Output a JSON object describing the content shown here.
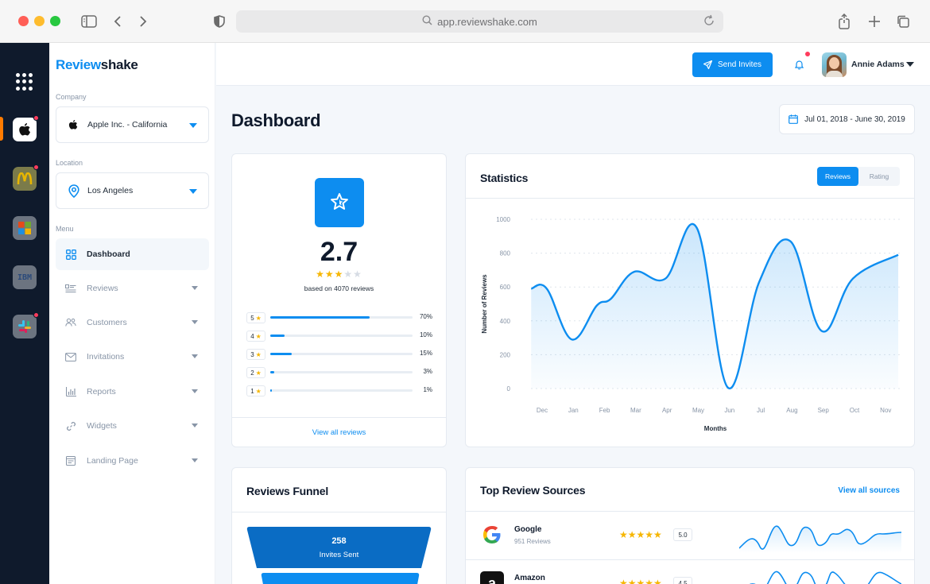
{
  "browser": {
    "url": "app.reviewshake.com"
  },
  "rail": {
    "apps": [
      {
        "name": "apple-app",
        "has_badge": true,
        "active": true
      },
      {
        "name": "mcdonalds-app",
        "has_badge": true,
        "active": false
      },
      {
        "name": "microsoft-app",
        "has_badge": false,
        "active": false
      },
      {
        "name": "ibm-app",
        "has_badge": false,
        "active": false,
        "glyph": "IBM"
      },
      {
        "name": "slack-app",
        "has_badge": true,
        "active": false
      }
    ]
  },
  "sidebar": {
    "logo_part1": "Review",
    "logo_part2": "shake",
    "company_label": "Company",
    "company_value": "Apple Inc. - California",
    "location_label": "Location",
    "location_value": "Los Angeles",
    "menu_label": "Menu",
    "items": [
      {
        "label": "Dashboard",
        "icon": "dashboard-icon",
        "active": true,
        "has_caret": false
      },
      {
        "label": "Reviews",
        "icon": "reviews-icon",
        "active": false,
        "has_caret": true
      },
      {
        "label": "Customers",
        "icon": "customers-icon",
        "active": false,
        "has_caret": true
      },
      {
        "label": "Invitations",
        "icon": "mail-icon",
        "active": false,
        "has_caret": true
      },
      {
        "label": "Reports",
        "icon": "bar-chart-icon",
        "active": false,
        "has_caret": true
      },
      {
        "label": "Widgets",
        "icon": "link-icon",
        "active": false,
        "has_caret": true
      },
      {
        "label": "Landing Page",
        "icon": "landing-page-icon",
        "active": false,
        "has_caret": true
      }
    ]
  },
  "topbar": {
    "send_invites": "Send Invites",
    "user_name": "Annie Adams"
  },
  "page": {
    "title": "Dashboard",
    "date_range": "Jul 01, 2018 - June 30, 2019"
  },
  "rating": {
    "value": "2.7",
    "stars_filled": 3,
    "stars_total": 5,
    "note": "based on 4070 reviews",
    "breakdown": [
      {
        "stars": "5",
        "percent": "70%",
        "fraction": 0.7
      },
      {
        "stars": "4",
        "percent": "10%",
        "fraction": 0.1
      },
      {
        "stars": "3",
        "percent": "15%",
        "fraction": 0.15
      },
      {
        "stars": "2",
        "percent": "3%",
        "fraction": 0.03
      },
      {
        "stars": "1",
        "percent": "1%",
        "fraction": 0.01
      }
    ],
    "view_all": "View all reviews"
  },
  "statistics": {
    "title": "Statistics",
    "tab_reviews": "Reviews",
    "tab_rating": "Rating",
    "active_tab": "Reviews"
  },
  "chart_data": {
    "type": "line",
    "title": "",
    "xlabel": "Months",
    "ylabel": "Number of Reviews",
    "categories": [
      "Dec",
      "Jan",
      "Feb",
      "Mar",
      "Apr",
      "May",
      "Jun",
      "Jul",
      "Aug",
      "Sep",
      "Oct",
      "Nov"
    ],
    "y_ticks": [
      0,
      200,
      400,
      600,
      800,
      1000
    ],
    "ylim": [
      0,
      1000
    ],
    "grid": true,
    "area_fill": true,
    "series": [
      {
        "values": [
          590,
          590,
          290,
          490,
          530,
          690,
          650,
          950,
          5,
          630,
          870,
          340,
          650,
          790
        ]
      }
    ],
    "x_positions": [
      -0.35,
      0.15,
      0.95,
      1.75,
      2.2,
      2.95,
      3.95,
      4.95,
      5.95,
      6.95,
      7.95,
      8.95,
      9.95,
      11.4
    ],
    "color": "#0d8df0"
  },
  "funnel": {
    "title": "Reviews Funnel",
    "top_value": "258",
    "top_label": "Invites Sent"
  },
  "sources": {
    "title": "Top Review Sources",
    "view_all": "View all sources",
    "items": [
      {
        "name": "Google",
        "count": "951 Reviews",
        "score": "5.0",
        "stars": "★★★★★",
        "icon": "google-logo-icon"
      },
      {
        "name": "Amazon",
        "count": "",
        "score": "4.5",
        "stars": "★★★★★",
        "icon": "amazon-logo-icon"
      }
    ]
  },
  "colors": {
    "accent": "#0d8df0",
    "rail": "#0f1a2c",
    "star": "#f6b600",
    "badge": "#ff3b5c"
  }
}
